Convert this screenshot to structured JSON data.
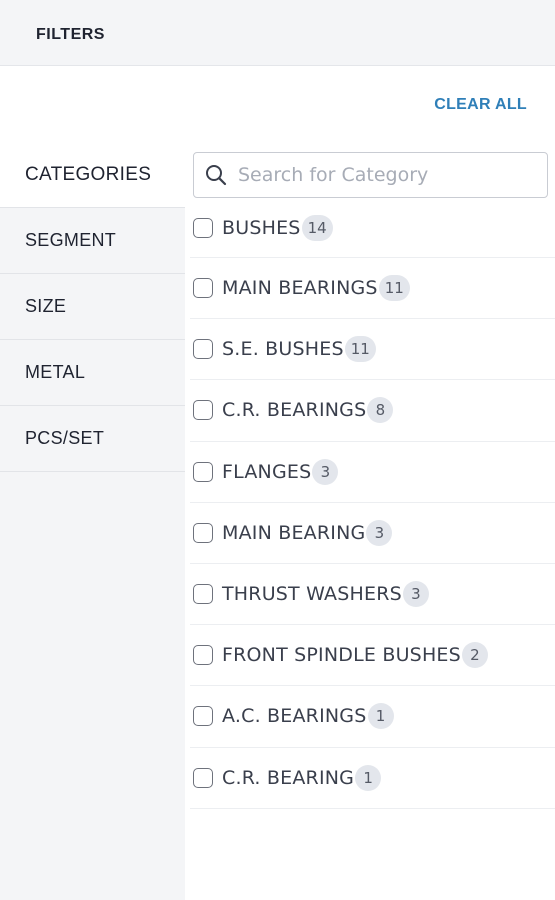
{
  "header": {
    "title": "FILTERS"
  },
  "actions": {
    "clear_all": "CLEAR ALL"
  },
  "sidebar": {
    "items": [
      {
        "label": "CATEGORIES",
        "active": true
      },
      {
        "label": "SEGMENT",
        "active": false
      },
      {
        "label": "SIZE",
        "active": false
      },
      {
        "label": "METAL",
        "active": false
      },
      {
        "label": "PCS/SET",
        "active": false
      }
    ]
  },
  "search": {
    "placeholder": "Search for Category",
    "value": ""
  },
  "categories": [
    {
      "label": "BUSHES",
      "count": "14",
      "checked": false
    },
    {
      "label": "MAIN BEARINGS",
      "count": "11",
      "checked": false
    },
    {
      "label": "S.E. BUSHES",
      "count": "11",
      "checked": false
    },
    {
      "label": "C.R. BEARINGS",
      "count": "8",
      "checked": false
    },
    {
      "label": "FLANGES",
      "count": "3",
      "checked": false
    },
    {
      "label": "MAIN BEARING",
      "count": "3",
      "checked": false
    },
    {
      "label": "THRUST WASHERS",
      "count": "3",
      "checked": false
    },
    {
      "label": "FRONT SPINDLE BUSHES",
      "count": "2",
      "checked": false
    },
    {
      "label": "A.C. BEARINGS",
      "count": "1",
      "checked": false
    },
    {
      "label": "C.R. BEARING",
      "count": "1",
      "checked": false
    }
  ],
  "colors": {
    "accent": "#2f7fb8",
    "panel_bg": "#f4f5f7",
    "badge_bg": "#e3e6ec"
  },
  "icons": {
    "search": "search-icon"
  }
}
